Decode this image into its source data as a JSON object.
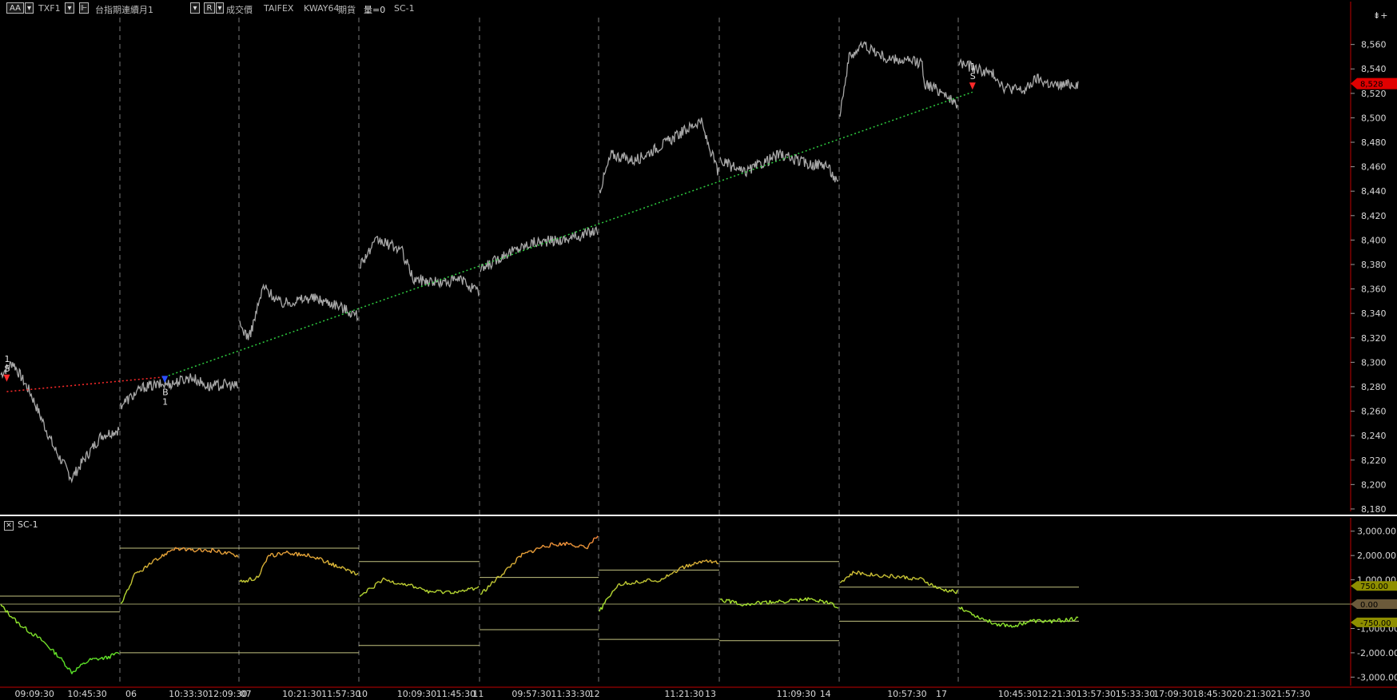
{
  "toolbar": {
    "font_button": "AA",
    "symbol": "TXF1",
    "symbol_name": "台指期連續月1",
    "r_button": "R",
    "field": "成交價",
    "exchange": "TAIFEX",
    "interval": "KWAY64",
    "market": "期貨",
    "volume": "量=0",
    "indicator": "SC-1",
    "corner": "⇟+"
  },
  "indicator_panel": {
    "close": "✕",
    "title": "SC-1"
  },
  "colors": {
    "price": "#a8a8a8",
    "sell_trend": "#ff2a2a",
    "buy_trend": "#2ecc40",
    "separator": "#ffffff",
    "axis_line": "#c00000",
    "guide": "#d8d890"
  },
  "chart_data": [
    {
      "type": "line",
      "panel": "price",
      "yticks": [
        8180,
        8200,
        8220,
        8240,
        8260,
        8280,
        8300,
        8320,
        8340,
        8360,
        8380,
        8400,
        8420,
        8440,
        8460,
        8480,
        8500,
        8520,
        8540,
        8560
      ],
      "ylim": [
        8178,
        8582
      ],
      "last_value": "8,528",
      "series": [
        {
          "segments": [
            [
              [
                0,
                8290
              ],
              [
                0.1,
                8300
              ],
              [
                0.25,
                8275
              ],
              [
                0.45,
                8230
              ],
              [
                0.6,
                8205
              ],
              [
                0.7,
                8220
              ],
              [
                0.85,
                8240
              ],
              [
                1,
                8245
              ]
            ],
            [
              [
                0,
                8265
              ],
              [
                0.2,
                8280
              ],
              [
                0.45,
                8283
              ],
              [
                0.6,
                8288
              ],
              [
                0.75,
                8280
              ],
              [
                0.9,
                8282
              ],
              [
                1,
                8280
              ]
            ],
            [
              [
                0,
                8330
              ],
              [
                0.08,
                8320
              ],
              [
                0.2,
                8362
              ],
              [
                0.35,
                8348
              ],
              [
                0.6,
                8353
              ],
              [
                0.8,
                8348
              ],
              [
                1,
                8338
              ]
            ],
            [
              [
                0,
                8380
              ],
              [
                0.15,
                8400
              ],
              [
                0.35,
                8392
              ],
              [
                0.45,
                8368
              ],
              [
                0.7,
                8365
              ],
              [
                0.85,
                8368
              ],
              [
                1,
                8357
              ]
            ],
            [
              [
                0,
                8375
              ],
              [
                0.2,
                8388
              ],
              [
                0.45,
                8398
              ],
              [
                0.7,
                8400
              ],
              [
                0.9,
                8405
              ],
              [
                1,
                8408
              ]
            ],
            [
              [
                0,
                8440
              ],
              [
                0.1,
                8470
              ],
              [
                0.3,
                8465
              ],
              [
                0.6,
                8482
              ],
              [
                0.85,
                8498
              ],
              [
                0.9,
                8482
              ],
              [
                1,
                8455
              ]
            ],
            [
              [
                0,
                8465
              ],
              [
                0.2,
                8455
              ],
              [
                0.5,
                8470
              ],
              [
                0.75,
                8462
              ],
              [
                0.9,
                8462
              ],
              [
                1,
                8445
              ]
            ],
            [
              [
                0,
                8505
              ],
              [
                0.08,
                8550
              ],
              [
                0.2,
                8560
              ],
              [
                0.4,
                8548
              ],
              [
                0.7,
                8545
              ],
              [
                0.72,
                8528
              ],
              [
                0.9,
                8520
              ],
              [
                1,
                8508
              ]
            ],
            [
              [
                0,
                8545
              ],
              [
                0.15,
                8540
              ],
              [
                0.3,
                8535
              ],
              [
                0.38,
                8525
              ],
              [
                0.55,
                8522
              ],
              [
                0.65,
                8532
              ],
              [
                0.8,
                8526
              ],
              [
                1,
                8528
              ]
            ]
          ]
        }
      ],
      "trades": [
        {
          "label_top": "1",
          "label_side": "S",
          "x_frac": 0.005,
          "price": 8286,
          "side": "sell"
        },
        {
          "label_top": "B",
          "label_side": "1",
          "x_frac": 0.122,
          "price": 8285,
          "side": "buy"
        },
        {
          "label_top": "1",
          "label_side": "S",
          "x_frac": 0.72,
          "price": 8525,
          "side": "sell"
        }
      ],
      "trend_lines": [
        {
          "from": [
            0.005,
            8276
          ],
          "to": [
            0.122,
            8288
          ],
          "color": "sell"
        },
        {
          "from": [
            0.122,
            8288
          ],
          "to": [
            0.72,
            8521
          ],
          "color": "buy"
        }
      ]
    },
    {
      "type": "line",
      "panel": "indicator",
      "name": "SC-1",
      "yticks": [
        -3000,
        -2000,
        -1000,
        0,
        1000,
        2000,
        3000
      ],
      "ytick_labels": [
        "-3,000.00",
        "-2,000.00",
        "-1,000.00",
        "0.00",
        "1,000.00",
        "2,000.00",
        "3,000.00"
      ],
      "ylim": [
        -3350,
        3550
      ],
      "tags": [
        {
          "value": 750,
          "text": "750.00",
          "color": "#8e8e00"
        },
        {
          "value": 0,
          "text": "0.00",
          "color": "#6b5a3a"
        },
        {
          "value": -750,
          "text": "-750.00",
          "color": "#8e8e00"
        }
      ],
      "bands": [
        {
          "upper": 330,
          "lower": -320
        },
        {
          "upper": 2300,
          "lower": -2000
        },
        {
          "upper": 2300,
          "lower": -2000
        },
        {
          "upper": 1750,
          "lower": -1700
        },
        {
          "upper": 1100,
          "lower": -1050
        },
        {
          "upper": 1400,
          "lower": -1450
        },
        {
          "upper": 1750,
          "lower": -1500
        },
        {
          "upper": 700,
          "lower": -700
        },
        {
          "upper": 700,
          "lower": -700
        }
      ],
      "segments": [
        [
          [
            0,
            -50
          ],
          [
            0.15,
            -800
          ],
          [
            0.35,
            -1500
          ],
          [
            0.5,
            -2200
          ],
          [
            0.6,
            -2800
          ],
          [
            0.75,
            -2300
          ],
          [
            0.9,
            -2200
          ],
          [
            1,
            -2000
          ]
        ],
        [
          [
            0,
            0
          ],
          [
            0.12,
            1200
          ],
          [
            0.3,
            1800
          ],
          [
            0.45,
            2300
          ],
          [
            0.6,
            2200
          ],
          [
            0.8,
            2200
          ],
          [
            1,
            2000
          ]
        ],
        [
          [
            0,
            900
          ],
          [
            0.15,
            1100
          ],
          [
            0.25,
            2000
          ],
          [
            0.4,
            2100
          ],
          [
            0.6,
            2000
          ],
          [
            0.85,
            1500
          ],
          [
            1,
            1200
          ]
        ],
        [
          [
            0,
            300
          ],
          [
            0.2,
            1000
          ],
          [
            0.4,
            800
          ],
          [
            0.6,
            500
          ],
          [
            0.85,
            500
          ],
          [
            1,
            700
          ]
        ],
        [
          [
            0,
            400
          ],
          [
            0.2,
            1300
          ],
          [
            0.35,
            2000
          ],
          [
            0.55,
            2400
          ],
          [
            0.75,
            2500
          ],
          [
            0.9,
            2300
          ],
          [
            1,
            2800
          ]
        ],
        [
          [
            0,
            -300
          ],
          [
            0.15,
            800
          ],
          [
            0.3,
            900
          ],
          [
            0.5,
            1000
          ],
          [
            0.7,
            1500
          ],
          [
            0.9,
            1800
          ],
          [
            1,
            1700
          ]
        ],
        [
          [
            0,
            200
          ],
          [
            0.2,
            0
          ],
          [
            0.5,
            100
          ],
          [
            0.75,
            200
          ],
          [
            0.9,
            100
          ],
          [
            1,
            -100
          ]
        ],
        [
          [
            0,
            900
          ],
          [
            0.12,
            1300
          ],
          [
            0.3,
            1200
          ],
          [
            0.55,
            1100
          ],
          [
            0.7,
            1000
          ],
          [
            0.85,
            600
          ],
          [
            1,
            500
          ]
        ],
        [
          [
            0,
            -100
          ],
          [
            0.15,
            -500
          ],
          [
            0.3,
            -800
          ],
          [
            0.45,
            -900
          ],
          [
            0.6,
            -700
          ],
          [
            0.8,
            -700
          ],
          [
            1,
            -600
          ]
        ]
      ]
    },
    {
      "type": "axis",
      "panel": "time",
      "session_separators": [
        "06",
        "07",
        "10",
        "11",
        "12",
        "13",
        "14",
        "17"
      ],
      "labels": [
        {
          "text": "09:09:30",
          "x_frac": 0.005
        },
        {
          "text": "10:45:30",
          "x_frac": 0.044
        },
        {
          "text": "06",
          "x_frac": 0.087
        },
        {
          "text": "10:33:30",
          "x_frac": 0.119
        },
        {
          "text": "12:09:30",
          "x_frac": 0.148
        },
        {
          "text": "07",
          "x_frac": 0.172
        },
        {
          "text": "10:21:30",
          "x_frac": 0.203
        },
        {
          "text": "11:57:30",
          "x_frac": 0.232
        },
        {
          "text": "10",
          "x_frac": 0.258
        },
        {
          "text": "10:09:30",
          "x_frac": 0.288
        },
        {
          "text": "11:45:30",
          "x_frac": 0.317
        },
        {
          "text": "11",
          "x_frac": 0.344
        },
        {
          "text": "09:57:30",
          "x_frac": 0.373
        },
        {
          "text": "11:33:30",
          "x_frac": 0.402
        },
        {
          "text": "12",
          "x_frac": 0.43
        },
        {
          "text": "11:21:30",
          "x_frac": 0.486
        },
        {
          "text": "13",
          "x_frac": 0.516
        },
        {
          "text": "11:09:30",
          "x_frac": 0.569
        },
        {
          "text": "14",
          "x_frac": 0.601
        },
        {
          "text": "10:57:30",
          "x_frac": 0.651
        },
        {
          "text": "17",
          "x_frac": 0.687
        },
        {
          "text": "10:45:30",
          "x_frac": 0.733
        },
        {
          "text": "12:21:30",
          "x_frac": 0.762
        },
        {
          "text": "13:57:30",
          "x_frac": 0.791
        },
        {
          "text": "15:33:30",
          "x_frac": 0.82
        },
        {
          "text": "17:09:30",
          "x_frac": 0.848
        },
        {
          "text": "18:45:30",
          "x_frac": 0.877
        },
        {
          "text": "20:21:30",
          "x_frac": 0.906
        },
        {
          "text": "21:57:30",
          "x_frac": 0.935
        }
      ]
    }
  ]
}
